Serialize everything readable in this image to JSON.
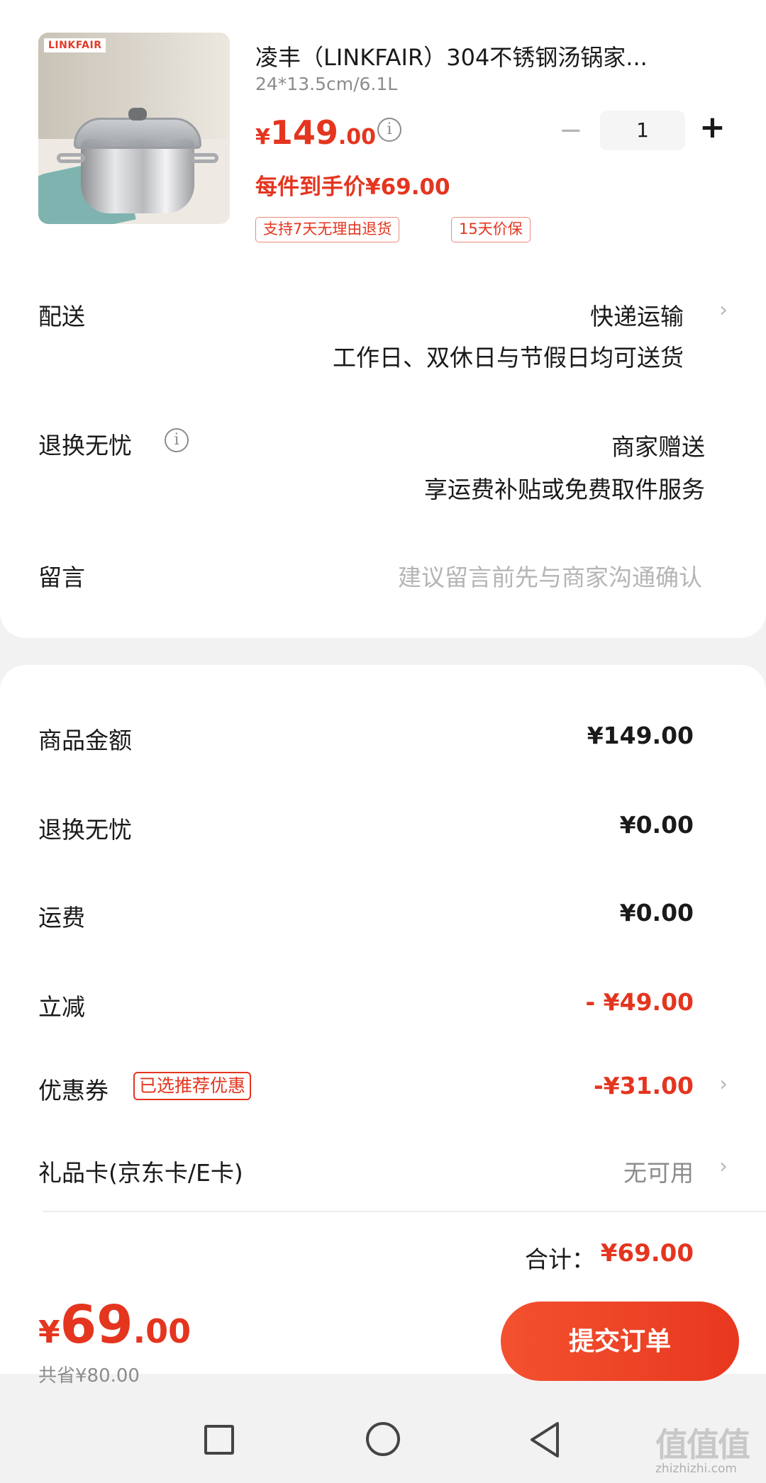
{
  "product": {
    "image_brand": "LINKFAIR",
    "title": "凌丰（LINKFAIR）304不锈钢汤锅家...",
    "spec": "24*13.5cm/6.1L",
    "price_symbol": "¥",
    "price_int": "149",
    "price_dec": ".00",
    "info_glyph": "i",
    "quantity": "1",
    "minus_glyph": "−",
    "plus_glyph": "+",
    "unit_price": "每件到手价¥69.00",
    "tags": [
      "支持7天无理由退货",
      "15天价保"
    ]
  },
  "delivery": {
    "label": "配送",
    "method": "快递运输",
    "note": "工作日、双休日与节假日均可送货"
  },
  "return": {
    "label": "退换无忧",
    "value": "商家赠送",
    "note": "享运费补贴或免费取件服务"
  },
  "message": {
    "label": "留言",
    "placeholder": "建议留言前先与商家沟通确认"
  },
  "summary": {
    "items": [
      {
        "label": "商品金额",
        "value": "¥149.00"
      },
      {
        "label": "退换无忧",
        "value": "¥0.00"
      },
      {
        "label": "运费",
        "value": "¥0.00"
      },
      {
        "label": "立减",
        "value": "- ¥49.00"
      },
      {
        "label": "优惠券",
        "value": "-¥31.00"
      },
      {
        "label": "礼品卡(京东卡/E卡)",
        "value": "无可用"
      }
    ],
    "coupon_badge": "已选推荐优惠",
    "total_label": "合计：",
    "total_value": "¥69.00"
  },
  "footer": {
    "price_symbol": "¥",
    "price_int": "69",
    "price_dec": ".00",
    "saved": "共省¥80.00",
    "submit_label": "提交订单"
  },
  "chevron": "›",
  "watermark": {
    "main": "值值值",
    "sub": "zhizhizhi.com"
  },
  "colors": {
    "accent": "#e4351f",
    "button": "#f3512f"
  }
}
